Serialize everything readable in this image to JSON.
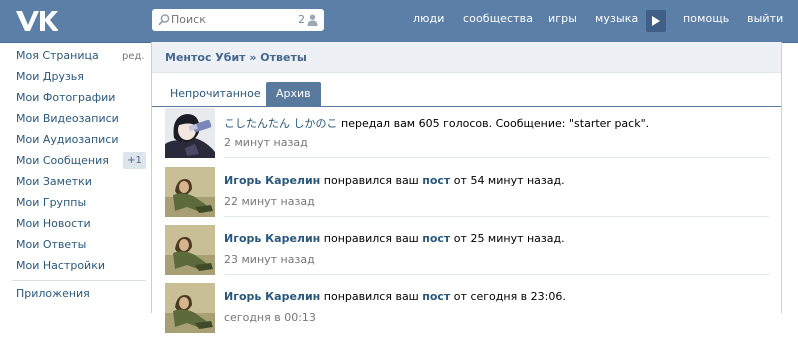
{
  "colors": {
    "topbar": "#5b7fa6",
    "link": "#2b587a",
    "tab_active": "#5a7a9d"
  },
  "logo": {
    "icon": "vk-logo-icon"
  },
  "search": {
    "placeholder": "Поиск",
    "count": "2",
    "icon": "search-icon",
    "people_icon": "people-icon"
  },
  "nav": {
    "people": "люди",
    "communities": "сообщества",
    "games": "игры",
    "music": "музыка",
    "music_play_icon": "play-icon",
    "help": "помощь",
    "logout": "выйти"
  },
  "sidebar": {
    "edit": "ред.",
    "items": [
      {
        "label": "Моя Страница"
      },
      {
        "label": "Мои Друзья"
      },
      {
        "label": "Мои Фотографии"
      },
      {
        "label": "Мои Видеозаписи"
      },
      {
        "label": "Мои Аудиозаписи"
      },
      {
        "label": "Мои Сообщения",
        "badge": "+1"
      },
      {
        "label": "Мои Заметки"
      },
      {
        "label": "Мои Группы"
      },
      {
        "label": "Мои Новости"
      },
      {
        "label": "Мои Ответы"
      },
      {
        "label": "Мои Настройки"
      }
    ],
    "apps": "Приложения"
  },
  "header": {
    "breadcrumb": "Ментос Убит » Ответы"
  },
  "tabs": {
    "unread": "Непрочитанное",
    "archive": "Архив"
  },
  "notifications": [
    {
      "user": "こしたんたん しかのこ",
      "text": " передал вам 605 голосов. Сообщение: \"starter pack\".",
      "time": "2 минут назад",
      "avatar": "anime-avatar"
    },
    {
      "user": "Игорь Карелин",
      "text_before": " понравился ваш ",
      "post": "пост",
      "text_after": " от 54 минут назад.",
      "time": "22 минут назад",
      "avatar": "photo-avatar"
    },
    {
      "user": "Игорь Карелин",
      "text_before": " понравился ваш ",
      "post": "пост",
      "text_after": " от 25 минут назад.",
      "time": "23 минут назад",
      "avatar": "photo-avatar"
    },
    {
      "user": "Игорь Карелин",
      "text_before": " понравился ваш ",
      "post": "пост",
      "text_after": " от сегодня в 23:06.",
      "time": "сегодня в 00:13",
      "avatar": "photo-avatar"
    }
  ]
}
